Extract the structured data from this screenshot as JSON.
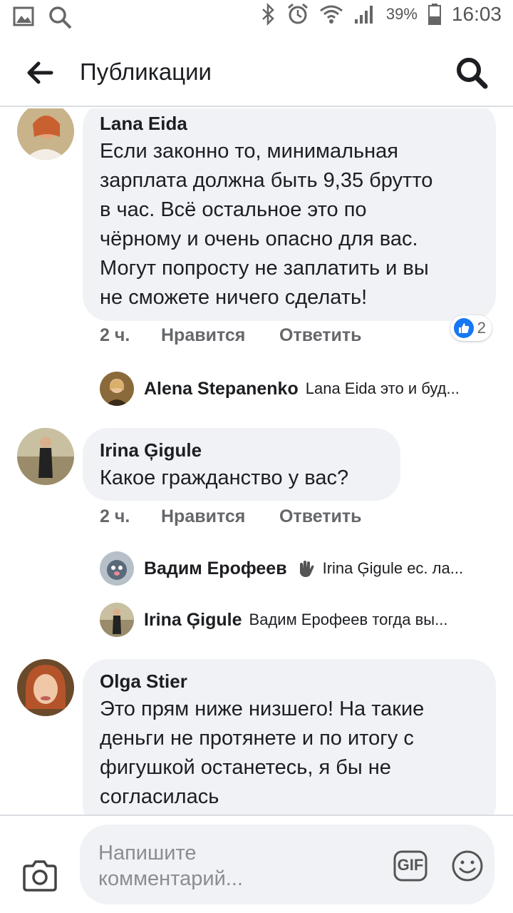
{
  "status_bar": {
    "battery": "39%",
    "time": "16:03",
    "icons": [
      "gallery-icon",
      "search-icon",
      "bluetooth-icon",
      "alarm-icon",
      "wifi-icon",
      "signal-icon",
      "battery-icon"
    ]
  },
  "header": {
    "title": "Публикации",
    "back_icon": "arrow-left-icon",
    "search_icon": "search-icon"
  },
  "comments": [
    {
      "author": "Lana Eida",
      "text": "Если законно то, минимальная\nзарплата должна быть 9,35 брутто\nв час. Всё остальное это по\nчёрному и очень опасно для вас.\nМогут попросту не заплатить и вы\nне сможете ничего сделать!",
      "time": "2 ч.",
      "like": "Нравится",
      "reply": "Ответить",
      "reactions": "2",
      "replies": [
        {
          "author": "Alena Stepanenko",
          "text": "Lana Eida это и буд..."
        }
      ]
    },
    {
      "author": "Irina Ģigule",
      "text": "Какое гражданство у вас?",
      "time": "2 ч.",
      "like": "Нравится",
      "reply": "Ответить",
      "replies": [
        {
          "author": "Вадим Ерофеев",
          "text": "Irina Ģigule ес. ла..."
        },
        {
          "author": "Irina Ģigule",
          "text": "Вадим Ерофеев  тогда вы..."
        }
      ]
    },
    {
      "author": "Olga Stier",
      "text": "Это прям ниже низшего! На такие\nденьги не протянете и по итогу с\nфигушкой останетесь, я бы не\nсогласилась"
    }
  ],
  "composer": {
    "placeholder": "Напишите комментарий...",
    "gif_label": "GIF"
  },
  "colors": {
    "bubble": "#f0f2f5",
    "meta_text": "#65676b",
    "like_blue": "#1877f2"
  }
}
